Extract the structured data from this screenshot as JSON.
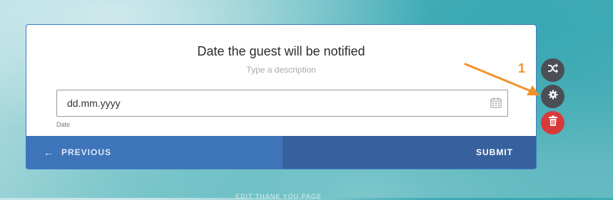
{
  "form": {
    "title": "Date the guest will be notified",
    "description_placeholder": "Type a description",
    "date_value": "dd.mm.yyyy",
    "date_sublabel": "Date",
    "previous_label": "PREVIOUS",
    "submit_label": "SUBMIT"
  },
  "annotation": {
    "badge": "1"
  },
  "background": {
    "text": "EDIT THANK YOU PAGE"
  },
  "icons": {
    "previous": "arrow-left-icon",
    "calendar": "calendar-icon",
    "shuffle": "shuffle-icon",
    "settings": "gear-icon",
    "delete": "trash-icon"
  },
  "colors": {
    "previous_bg": "#3e74b9",
    "submit_bg": "#36619c",
    "delete_bg": "#d83a3a",
    "tool_bg": "#4b4f55",
    "annotation": "#f2922b"
  }
}
